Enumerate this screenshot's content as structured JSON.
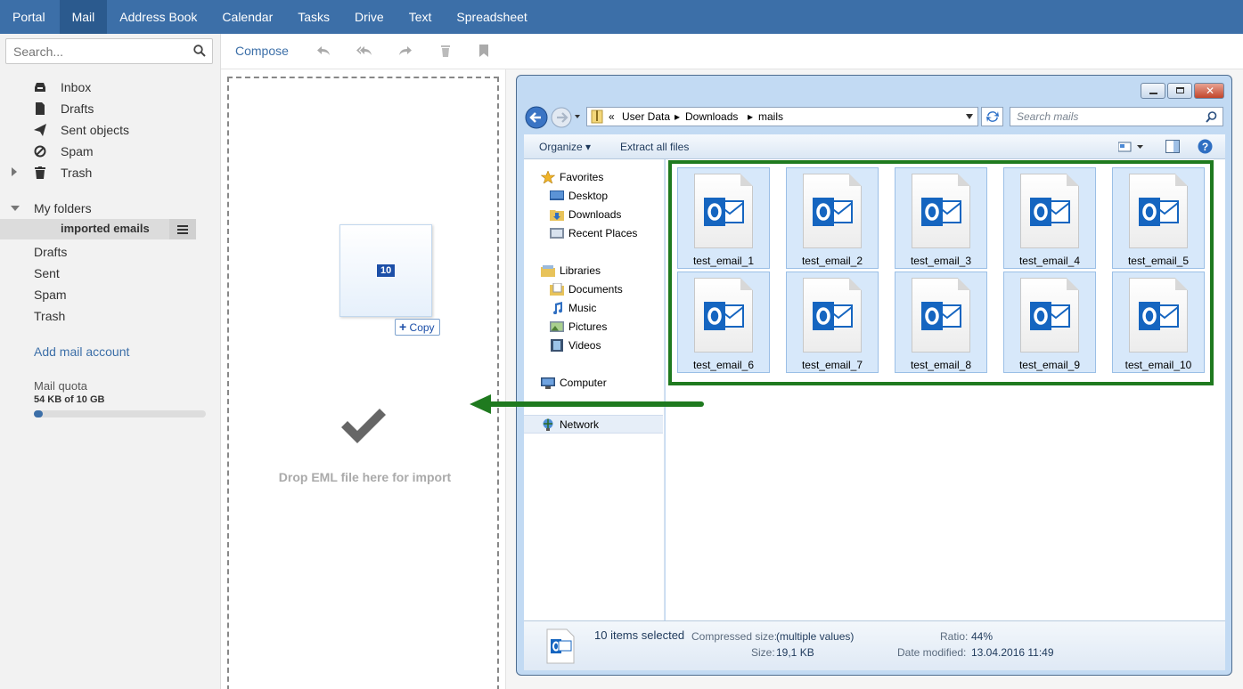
{
  "topnav": {
    "tabs": [
      "Portal",
      "Mail",
      "Address Book",
      "Calendar",
      "Tasks",
      "Drive",
      "Text",
      "Spreadsheet"
    ],
    "active": "Mail"
  },
  "sidebar": {
    "search_placeholder": "Search...",
    "folders": [
      {
        "label": "Inbox",
        "icon": "inbox-icon"
      },
      {
        "label": "Drafts",
        "icon": "drafts-icon"
      },
      {
        "label": "Sent objects",
        "icon": "send-icon"
      },
      {
        "label": "Spam",
        "icon": "spam-icon"
      },
      {
        "label": "Trash",
        "icon": "trash-icon"
      }
    ],
    "my_folders_label": "My folders",
    "active_folder": "imported emails",
    "subfolders": [
      "Drafts",
      "Sent",
      "Spam",
      "Trash"
    ],
    "add_account": "Add mail account",
    "quota_label": "Mail quota",
    "quota_value": "54 KB of 10 GB",
    "quota_fraction": 0.05
  },
  "toolbar": {
    "compose": "Compose",
    "icons": [
      "reply-icon",
      "reply-all-icon",
      "forward-icon",
      "delete-icon",
      "flag-icon"
    ]
  },
  "dropzone": {
    "text": "Drop EML file here for import",
    "drag_count": "10",
    "copy_label": "Copy"
  },
  "explorer": {
    "breadcrumb": [
      "User Data",
      "Downloads",
      "mails"
    ],
    "breadcrumb_prefix": "«",
    "search_placeholder": "Search mails",
    "commands": {
      "organize": "Organize ▾",
      "extract": "Extract all files"
    },
    "nav": {
      "favorites": "Favorites",
      "desktop": "Desktop",
      "downloads": "Downloads",
      "recent": "Recent Places",
      "libraries": "Libraries",
      "documents": "Documents",
      "music": "Music",
      "pictures": "Pictures",
      "videos": "Videos",
      "computer": "Computer",
      "network": "Network"
    },
    "files": [
      "test_email_1",
      "test_email_2",
      "test_email_3",
      "test_email_4",
      "test_email_5",
      "test_email_6",
      "test_email_7",
      "test_email_8",
      "test_email_9",
      "test_email_10"
    ],
    "details": {
      "selected": "10 items selected",
      "compressed_label": "Compressed size:",
      "compressed_value": "(multiple values)",
      "size_label": "Size:",
      "size_value": "19,1 KB",
      "ratio_label": "Ratio:",
      "ratio_value": "44%",
      "modified_label": "Date modified:",
      "modified_value": "13.04.2016 11:49"
    }
  },
  "colors": {
    "accent": "#3c6fa8",
    "highlight": "#1f7a1f",
    "arrow": "#1f7a1f"
  }
}
